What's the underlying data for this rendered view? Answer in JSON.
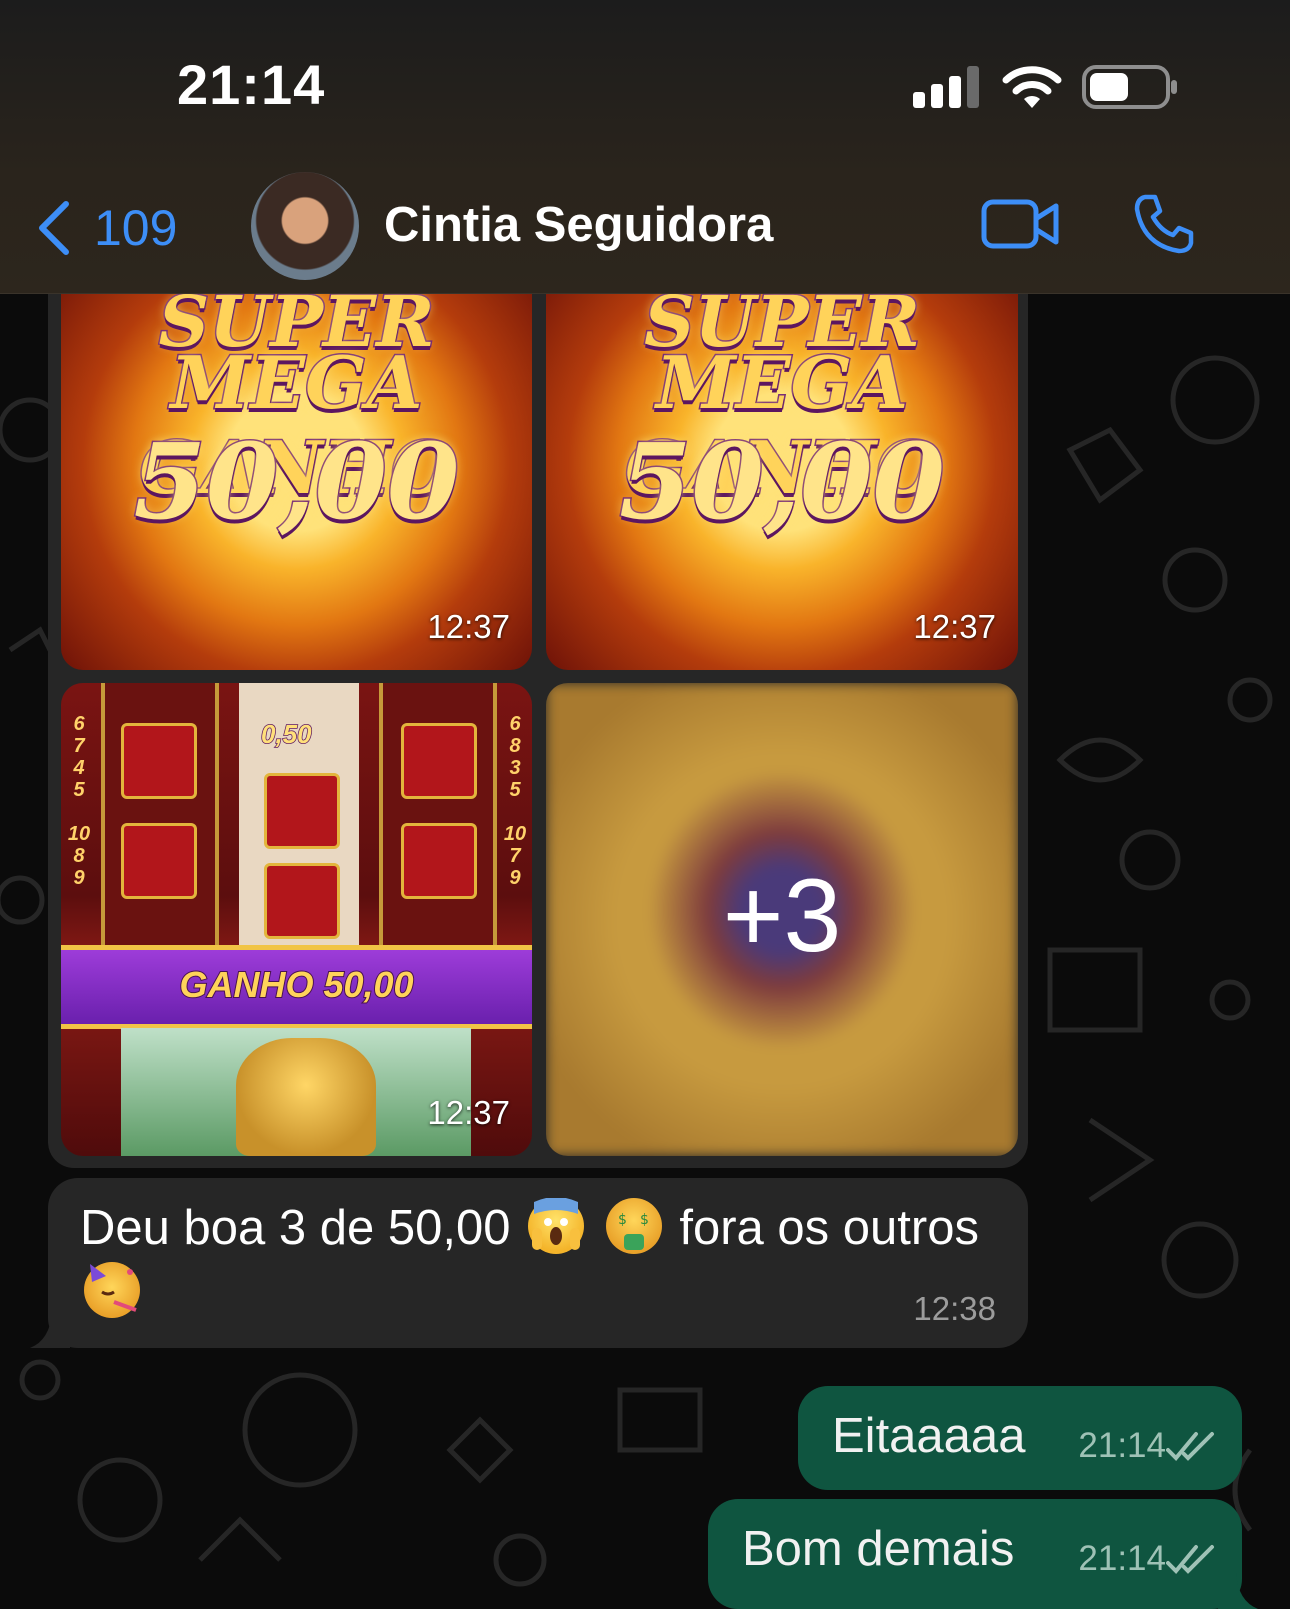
{
  "status_bar": {
    "time": "21:14"
  },
  "header": {
    "back_count": "109",
    "contact_name": "Cintia Seguidora"
  },
  "media_grid": {
    "tiles": [
      {
        "line1": "SUPER",
        "line2": "MEGA GANHO",
        "amount": "50,00",
        "time": "12:37"
      },
      {
        "line1": "SUPER",
        "line2": "MEGA GANHO",
        "amount": "50,00",
        "time": "12:37"
      },
      {
        "slot_value": "0,50",
        "banner": "GANHO 50,00",
        "time": "12:37"
      },
      {
        "more_count": "+3"
      }
    ]
  },
  "incoming_message": {
    "text_part1": "Deu boa 3 de 50,00",
    "text_part2": "fora os outros",
    "emojis": [
      "face-screaming-icon",
      "money-mouth-face-icon",
      "partying-face-icon"
    ],
    "time": "12:38"
  },
  "outgoing_messages": [
    {
      "text": "Eitaaaaa",
      "time": "21:14",
      "status": "read"
    },
    {
      "text": "Bom demais",
      "time": "21:14",
      "status": "read"
    }
  ],
  "colors": {
    "accent_blue": "#3d8ef7",
    "incoming_bubble": "#262626",
    "outgoing_bubble": "#0f5540",
    "background": "#0b0b0b"
  }
}
